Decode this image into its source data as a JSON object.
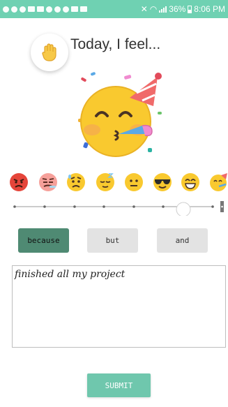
{
  "status_bar": {
    "battery": "36%",
    "time": "8:06 PM"
  },
  "header": {
    "title": "Today, I feel...",
    "hand_icon": "raised-hand-icon"
  },
  "current_mood": {
    "emoji": "partying-face"
  },
  "mood_options": [
    "angry-face",
    "woozy-face",
    "worried-face",
    "sleepy-face",
    "neutral-face",
    "sunglasses-face",
    "grinning-face",
    "partying-face"
  ],
  "slider": {
    "steps": 8,
    "selected_index": 6
  },
  "conjunctions": [
    {
      "label": "because",
      "active": true
    },
    {
      "label": "but",
      "active": false
    },
    {
      "label": "and",
      "active": false
    }
  ],
  "note": {
    "text": "finished all my project"
  },
  "submit": {
    "label": "SUBMIT"
  },
  "colors": {
    "accent": "#6fd1b2",
    "active_button": "#4f8a73",
    "inactive_button": "#e3e3e3",
    "submit": "#6fc7ad"
  }
}
